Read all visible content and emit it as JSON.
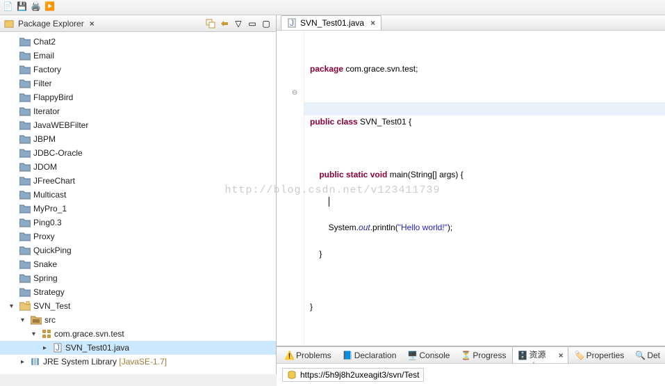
{
  "explorer": {
    "title": "Package Explorer",
    "projects": [
      "Chat2",
      "Email",
      "Factory",
      "Filter",
      "FlappyBird",
      "Iterator",
      "JavaWEBFilter",
      "JBPM",
      "JDBC-Oracle",
      "JDOM",
      "JFreeChart",
      "Multicast",
      "MyPro_1",
      "Ping0.3",
      "Proxy",
      "QuickPing",
      "Snake",
      "Spring",
      "Strategy"
    ],
    "active_project": "SVN_Test",
    "src_label": "src",
    "package_label": "com.grace.svn.test",
    "file_label": "SVN_Test01.java",
    "jre_label": "JRE System Library",
    "jre_decor": "[JavaSE-1.7]"
  },
  "editor": {
    "tab_label": "SVN_Test01.java",
    "code": {
      "l1a": "package",
      "l1b": " com.grace.svn.test;",
      "l3a": "public",
      "l3b": " class",
      "l3c": " SVN_Test01 {",
      "l5a": "    public",
      "l5b": " static",
      "l5c": " void",
      "l5d": " main(String[] args) {",
      "l6": "        ",
      "l7a": "        System.",
      "l7b": "out",
      "l7c": ".println(",
      "l7d": "\"Hello world!\"",
      "l7e": ");",
      "l8": "    }",
      "l10": "}"
    }
  },
  "watermark": "http://blog.csdn.net/v123411739",
  "bottom": {
    "tabs": [
      "Problems",
      "Declaration",
      "Console",
      "Progress",
      "SVN 资源库",
      "Properties",
      "Det"
    ],
    "active_index": 4,
    "url": "https://5h9j8h2uxeagit3/svn/Test"
  }
}
